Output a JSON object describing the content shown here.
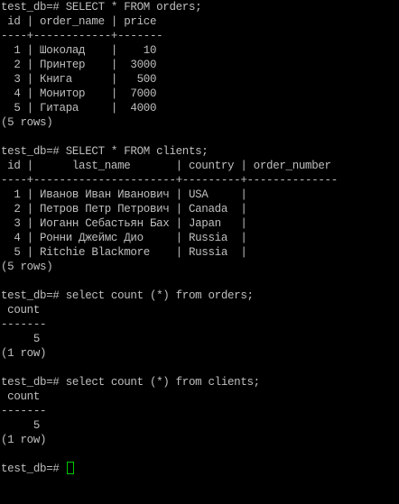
{
  "terminal": {
    "lines": [
      "test_db=# SELECT * FROM orders;",
      " id | order_name | price",
      "----+------------+-------",
      "  1 | Шоколад    |    10",
      "  2 | Принтер    |  3000",
      "  3 | Книга      |   500",
      "  4 | Монитор    |  7000",
      "  5 | Гитара     |  4000",
      "(5 rows)",
      "",
      "test_db=# SELECT * FROM clients;",
      " id |      last_name       | country | order_number",
      "----+----------------------+---------+--------------",
      "  1 | Иванов Иван Иванович | USA     |",
      "  2 | Петров Петр Петрович | Canada  |",
      "  3 | Иоганн Себастьян Бах | Japan   |",
      "  4 | Ронни Джеймс Дио     | Russia  |",
      "  5 | Ritchie Blackmore    | Russia  |",
      "(5 rows)",
      "",
      "test_db=# select count (*) from orders;",
      " count",
      "-------",
      "     5",
      "(1 row)",
      "",
      "test_db=# select count (*) from clients;",
      " count",
      "-------",
      "     5",
      "(1 row)",
      "",
      "test_db=# "
    ],
    "colors": {
      "background": "#000000",
      "text": "#bfbfbf",
      "cursor": "#00c800"
    }
  }
}
